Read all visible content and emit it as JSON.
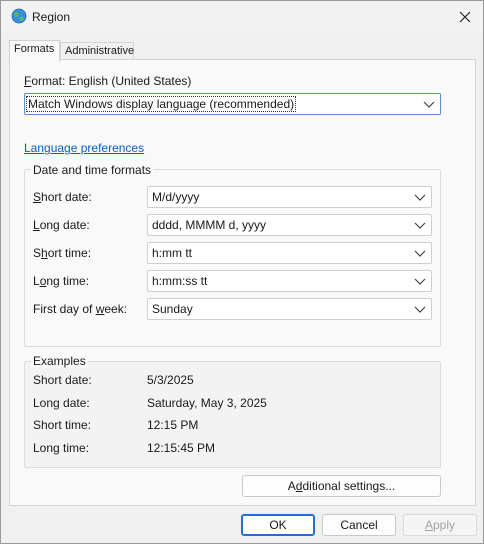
{
  "window": {
    "title": "Region",
    "icon": "globe-icon"
  },
  "tabs": [
    {
      "label": "Formats",
      "active": true
    },
    {
      "label": "Administrative",
      "active": false
    }
  ],
  "format": {
    "label_prefix": "F",
    "label_rest": "ormat: English (United States)",
    "selected": "Match Windows display language (recommended)"
  },
  "language_preferences_link": "Language preferences",
  "date_time_formats": {
    "title": "Date and time formats",
    "fields": [
      {
        "pre": "",
        "key": "S",
        "post": "hort date:",
        "value": "M/d/yyyy"
      },
      {
        "pre": "",
        "key": "L",
        "post": "ong date:",
        "value": "dddd, MMMM d, yyyy"
      },
      {
        "pre": "S",
        "key": "h",
        "post": "ort time:",
        "value": "h:mm tt"
      },
      {
        "pre": "L",
        "key": "o",
        "post": "ng time:",
        "value": "h:mm:ss tt"
      },
      {
        "pre": "First day of ",
        "key": "w",
        "post": "eek:",
        "value": "Sunday"
      }
    ]
  },
  "examples": {
    "title": "Examples",
    "rows": [
      {
        "label": "Short date:",
        "value": "5/3/2025"
      },
      {
        "label": "Long date:",
        "value": "Saturday, May 3, 2025"
      },
      {
        "label": "Short time:",
        "value": "12:15 PM"
      },
      {
        "label": "Long time:",
        "value": "12:15:45 PM"
      }
    ]
  },
  "buttons": {
    "additional_settings_pre": "A",
    "additional_settings_key": "d",
    "additional_settings_post": "ditional settings...",
    "ok": "OK",
    "cancel": "Cancel",
    "apply_key": "A",
    "apply_rest": "pply"
  }
}
